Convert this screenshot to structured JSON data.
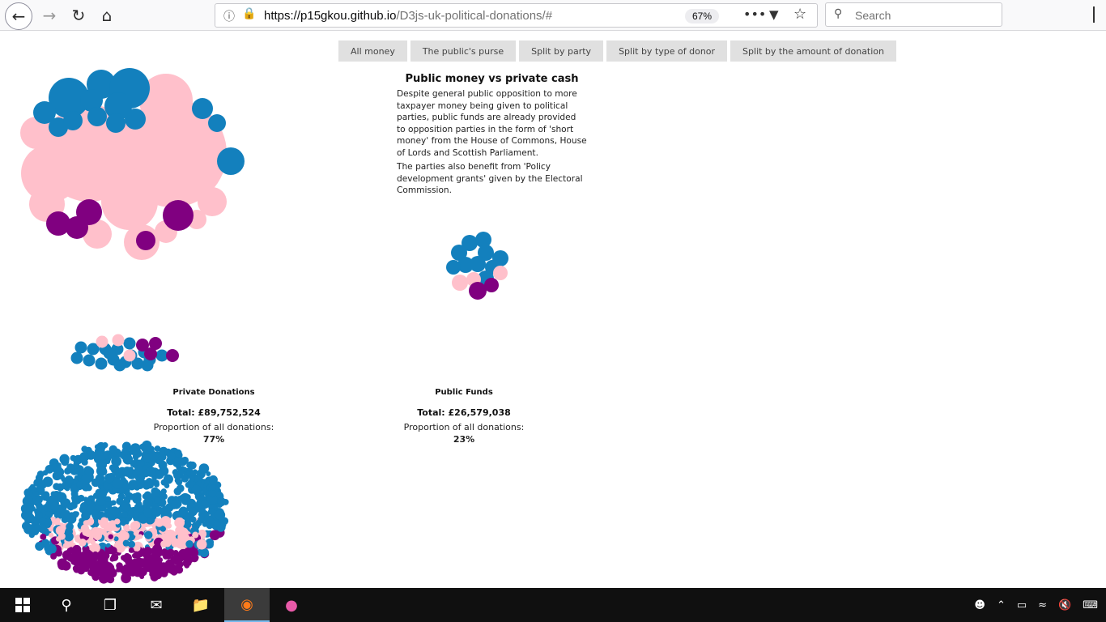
{
  "browser": {
    "url_host": "https://p15gkou.github.io",
    "url_path": "/D3js-uk-political-donations/#",
    "zoom": "67%",
    "search_placeholder": "Search"
  },
  "tabs": [
    {
      "label": "All money"
    },
    {
      "label": "The public's purse"
    },
    {
      "label": "Split by party"
    },
    {
      "label": "Split by type of donor"
    },
    {
      "label": "Split by the amount of donation"
    }
  ],
  "info": {
    "title": "Public money vs private cash",
    "paragraph1": "Despite general public opposition to more taxpayer money being given to political parties, public funds are already provided to opposition parties in the form of 'short money' from the House of Commons, House of Lords and Scottish Parliament.",
    "paragraph2": "The parties also benefit from 'Policy development grants' given by the Electoral Commission."
  },
  "groups": {
    "private": {
      "label": "Private Donations",
      "total": "Total: £89,752,524",
      "proportion_label": "Proportion of all donations:",
      "proportion": "77%"
    },
    "public": {
      "label": "Public Funds",
      "total": "Total: £26,579,038",
      "proportion_label": "Proportion of all donations:",
      "proportion": "23%"
    }
  },
  "colors": {
    "party_a": "#1380bd",
    "party_b": "#ffc0cb",
    "party_c": "#800080"
  }
}
